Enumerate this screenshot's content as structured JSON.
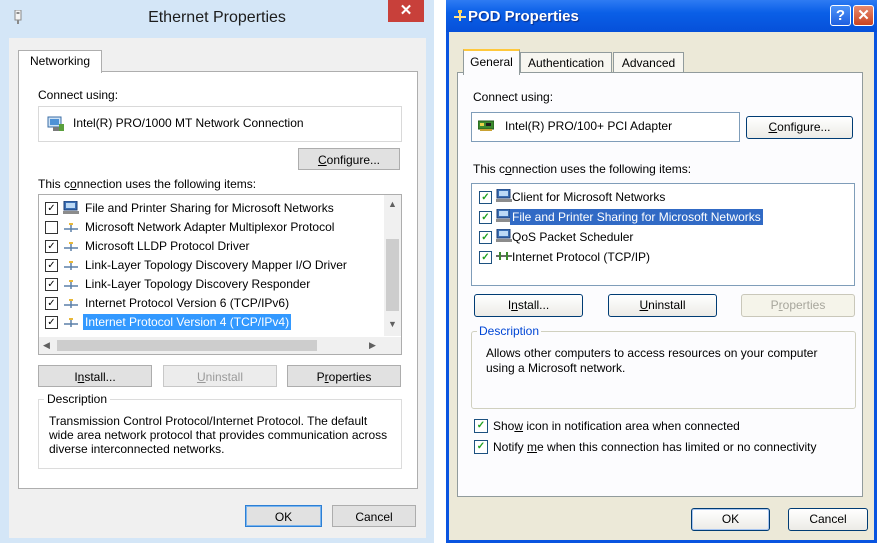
{
  "left": {
    "title": "Ethernet Properties",
    "tab": "Networking",
    "connect_using": "Connect using:",
    "adapter": "Intel(R) PRO/1000 MT Network Connection",
    "configure": {
      "pre": "",
      "ul": "C",
      "post": "onfigure..."
    },
    "items_label": {
      "pre": "This c",
      "ul": "o",
      "post": "nnection uses the following items:"
    },
    "items": [
      {
        "label": "File and Printer Sharing for Microsoft Networks",
        "checked": true,
        "icon": "computer-icon"
      },
      {
        "label": "Microsoft Network Adapter Multiplexor Protocol",
        "checked": false,
        "icon": "protocol-icon"
      },
      {
        "label": "Microsoft LLDP Protocol Driver",
        "checked": true,
        "icon": "protocol-icon"
      },
      {
        "label": "Link-Layer Topology Discovery Mapper I/O Driver",
        "checked": true,
        "icon": "protocol-icon"
      },
      {
        "label": "Link-Layer Topology Discovery Responder",
        "checked": true,
        "icon": "protocol-icon"
      },
      {
        "label": "Internet Protocol Version 6 (TCP/IPv6)",
        "checked": true,
        "icon": "protocol-icon"
      },
      {
        "label": "Internet Protocol Version 4 (TCP/IPv4)",
        "checked": true,
        "icon": "protocol-icon",
        "selected": true
      }
    ],
    "install": {
      "pre": "I",
      "ul": "n",
      "post": "stall..."
    },
    "uninstall": {
      "pre": "",
      "ul": "U",
      "post": "ninstall"
    },
    "properties": {
      "pre": "P",
      "ul": "r",
      "post": "operties"
    },
    "description_legend": "Description",
    "description": "Transmission Control Protocol/Internet Protocol. The default wide area network protocol that provides communication across diverse interconnected networks.",
    "ok": "OK",
    "cancel": "Cancel"
  },
  "right": {
    "title": "POD Properties",
    "tabs": [
      "General",
      "Authentication",
      "Advanced"
    ],
    "active_tab": "General",
    "connect_using": "Connect using:",
    "adapter": "Intel(R) PRO/100+ PCI Adapter",
    "configure": {
      "pre": "",
      "ul": "C",
      "post": "onfigure..."
    },
    "items_label": {
      "pre": "This c",
      "ul": "o",
      "post": "nnection uses the following items:"
    },
    "items": [
      {
        "label": "Client for Microsoft Networks",
        "checked": true,
        "icon": "client-icon"
      },
      {
        "label": "File and Printer Sharing for Microsoft Networks",
        "checked": true,
        "icon": "computer-icon",
        "selected": true
      },
      {
        "label": "QoS Packet Scheduler",
        "checked": true,
        "icon": "computer-icon"
      },
      {
        "label": "Internet Protocol (TCP/IP)",
        "checked": true,
        "icon": "network-icon"
      }
    ],
    "install": {
      "pre": "I",
      "ul": "n",
      "post": "stall..."
    },
    "uninstall": {
      "pre": "",
      "ul": "U",
      "post": "ninstall"
    },
    "properties": {
      "pre": "P",
      "ul": "r",
      "post": "operties"
    },
    "description_legend": "Description",
    "description": "Allows other computers to access resources on your computer using a Microsoft network.",
    "show_icon": {
      "pre": "Sho",
      "ul": "w",
      "post": " icon in notification area when connected",
      "checked": true
    },
    "notify": {
      "pre": "Notify ",
      "ul": "m",
      "post": "e when this connection has limited or no connectivity",
      "checked": true
    },
    "ok": "OK",
    "cancel": "Cancel"
  }
}
